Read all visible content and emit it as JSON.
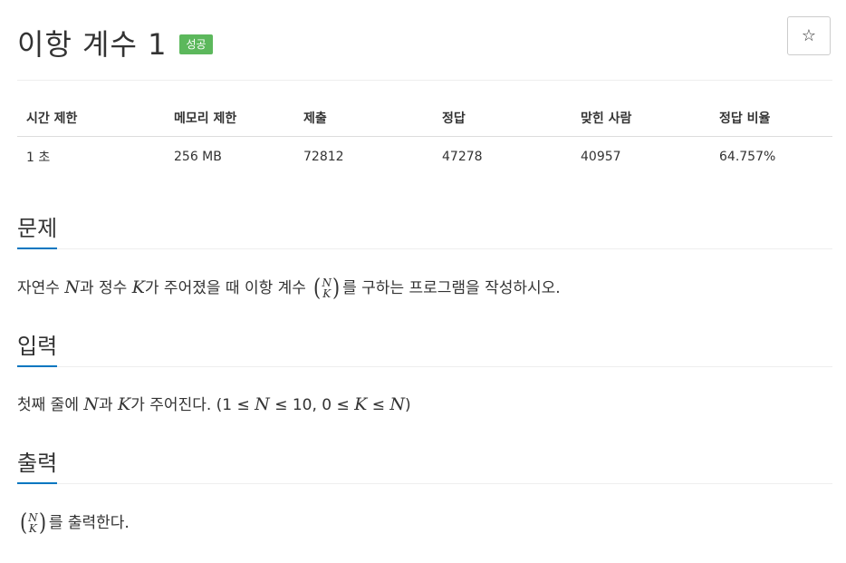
{
  "header": {
    "title": "이항 계수 1",
    "badge": "성공",
    "star_label": "☆"
  },
  "stats": {
    "columns": [
      "시간 제한",
      "메모리 제한",
      "제출",
      "정답",
      "맞힌 사람",
      "정답 비율"
    ],
    "values": [
      "1 초",
      "256 MB",
      "72812",
      "47278",
      "40957",
      "64.757%"
    ]
  },
  "problem": {
    "title": "문제",
    "text_1": "자연수 ",
    "var_n": "N",
    "text_2": "과 정수 ",
    "var_k": "K",
    "text_3": "가 주어졌을 때 이항 계수 ",
    "binom_top": "N",
    "binom_bottom": "K",
    "paren_open": "(",
    "paren_close": ")",
    "text_4": "를 구하는 프로그램을 작성하시오."
  },
  "input": {
    "title": "입력",
    "text_1": "첫째 줄에 ",
    "var_n": "N",
    "text_2": "과 ",
    "var_k": "K",
    "text_3": "가 주어진다. (1 ≤ ",
    "var_n2": "N",
    "text_4": " ≤ 10, 0 ≤ ",
    "var_k2": "K",
    "text_5": " ≤ ",
    "var_n3": "N",
    "text_6": ")"
  },
  "output": {
    "title": "출력",
    "binom_top": "N",
    "binom_bottom": "K",
    "paren_open": "(",
    "paren_close": ")",
    "text_1": "를 출력한다."
  },
  "colors": {
    "badge": "#5cb85c",
    "accent_underline": "#0076c0"
  }
}
